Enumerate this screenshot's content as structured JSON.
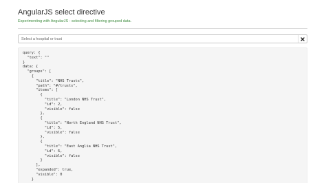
{
  "header": {
    "title": "AngularJS select directive",
    "subtitle": "Experimenting with AngularJS - selecting and filtering grouped data."
  },
  "search": {
    "placeholder": "Select a hospital or trust",
    "value": "",
    "clear_icon": "close-icon"
  },
  "colors": {
    "subtitle": "#3d8b3d",
    "panel_background": "#f5f5f5",
    "divider": "#d9d9d9"
  },
  "debug": {
    "code": "query: {\n  \"text\": \"\"\n}\ndata: {\n  \"groups\": [\n    {\n      \"title\": \"NHS Trusts\",\n      \"path\": \"#/trusts\",\n      \"items\": [\n        {\n          \"title\": \"London NHS Trust\",\n          \"id\": 2,\n          \"visible\": false\n        },\n        {\n          \"title\": \"North England NHS Trust\",\n          \"id\": 5,\n          \"visible\": false\n        },\n        {\n          \"title\": \"East Anglia NHS Trust\",\n          \"id\": 6,\n          \"visible\": false\n        }\n      ],\n      \"expanded\": true,\n      \"visible\": 0\n    }"
  }
}
